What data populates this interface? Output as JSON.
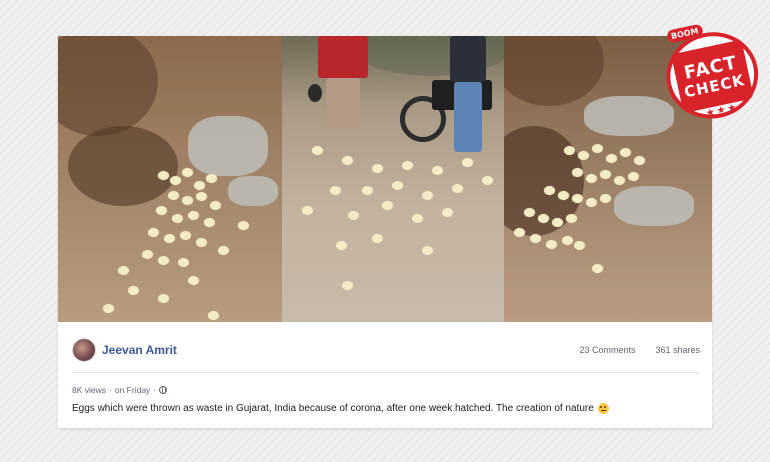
{
  "post": {
    "author": "Jeevan Amrit",
    "comments": "23 Comments",
    "shares": "361 shares",
    "views": "8K views",
    "separator": "·",
    "time": "on Friday",
    "caption": "Eggs which were thrown as waste in Gujarat, India because of corona, after one week hatched. The creation of nature"
  },
  "badge": {
    "top": "BOOM",
    "line1": "FACT",
    "line2": "CHECK",
    "stars": "★★★"
  },
  "colors": {
    "author_link": "#3b5998",
    "badge_red": "#d8232a"
  },
  "icons": {
    "globe": "globe-icon",
    "emoji": "thinking-face-emoji"
  }
}
